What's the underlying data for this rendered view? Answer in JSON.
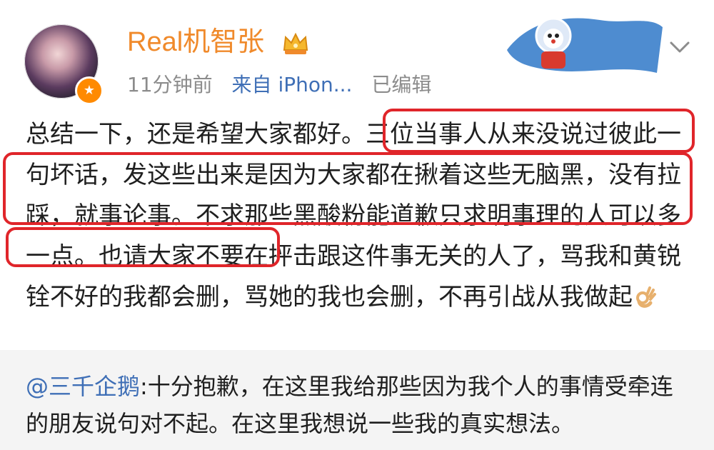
{
  "post": {
    "username": "Real机智张",
    "time_ago": "11分钟前",
    "source": "来自 iPhon...",
    "edited": "已编辑",
    "body": "总结一下，还是希望大家都好。三位当事人从来没说过彼此一句坏话，发这些出来是因为大家都在揪着这些无脑黑，没有拉踩，就事论事。不求那些黑酸粉能道歉只求明事理的人可以多一点。也请大家不要在抨击跟这件事无关的人了，骂我和黄锐铨不好的我都会删，骂她的我也会删，不再引战从我做起"
  },
  "icons": {
    "avatar_badge": "verified-badge-icon",
    "crown": "crown-icon",
    "chevron": "chevron-down-icon",
    "emoji": "ok-hand-icon",
    "sticker": "doraemon-sticker"
  },
  "repost": {
    "mention": "@三千企鹅",
    "text": ":十分抱歉，在这里我给那些因为我个人的事情受牵连的朋友说句对不起。在这里我想说一些我的真实想法。"
  },
  "colors": {
    "username": "#f08a2b",
    "meta": "#8c8c8c",
    "link": "#3f6fb6",
    "highlight_box": "#e0252a",
    "repost_bg": "#f4f4f4"
  }
}
